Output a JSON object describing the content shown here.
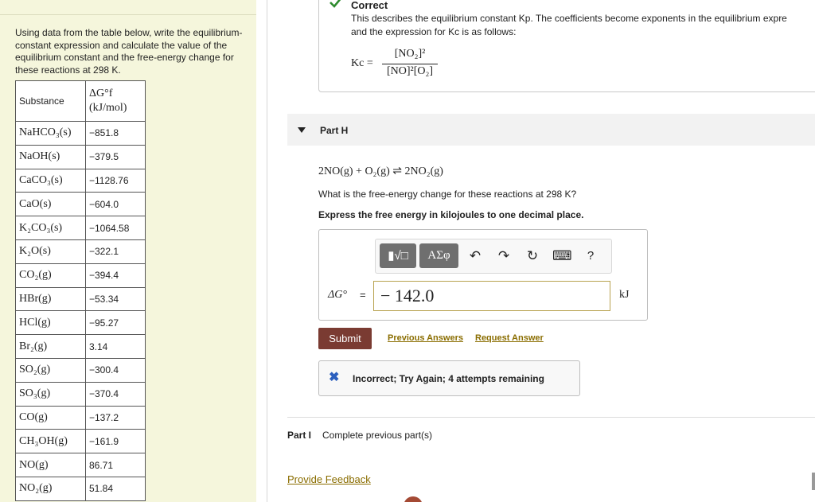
{
  "left_panel": {
    "instructions": "Using data from the table below, write the equilibrium-constant expression and calculate the value of the equilibrium constant and the free-energy change for these reactions at 298 K.",
    "table": {
      "headers": [
        "Substance",
        "ΔG°f (kJ/mol)"
      ],
      "rows": [
        {
          "substance": "NaHCO₃(s)",
          "value": "−851.8"
        },
        {
          "substance": "NaOH(s)",
          "value": "−379.5"
        },
        {
          "substance": "CaCO₃(s)",
          "value": "−1128.76"
        },
        {
          "substance": "CaO(s)",
          "value": "−604.0"
        },
        {
          "substance": "K₂CO₃(s)",
          "value": "−1064.58"
        },
        {
          "substance": "K₂O(s)",
          "value": "−322.1"
        },
        {
          "substance": "CO₂(g)",
          "value": "−394.4"
        },
        {
          "substance": "HBr(g)",
          "value": "−53.34"
        },
        {
          "substance": "HCl(g)",
          "value": "−95.27"
        },
        {
          "substance": "Br₂(g)",
          "value": "3.14"
        },
        {
          "substance": "SO₂(g)",
          "value": "−300.4"
        },
        {
          "substance": "SO₃(g)",
          "value": "−370.4"
        },
        {
          "substance": "CO(g)",
          "value": "−137.2"
        },
        {
          "substance": "CH₃OH(g)",
          "value": "−161.9"
        },
        {
          "substance": "NO(g)",
          "value": "86.71"
        },
        {
          "substance": "NO₂(g)",
          "value": "51.84"
        }
      ]
    }
  },
  "correct_box": {
    "title": "Correct",
    "line1": "This describes the equilibrium constant Kp. The coefficients become exponents in the equilibrium expre",
    "line2": "and the expression for Kc is as follows:",
    "kc_label": "Kc =",
    "numerator": "[NO₂]²",
    "denominator": "[NO]²[O₂]"
  },
  "part_h": {
    "label": "Part H",
    "reaction": "2NO(g) + O₂(g) ⇌ 2NO₂(g)",
    "question": "What is the free-energy change for these reactions at 298 K?",
    "instruction": "Express the free energy in kilojoules to one decimal place.",
    "toolbar": {
      "template_btn": "▮√□",
      "symbols_btn": "ΑΣφ",
      "undo": "↶",
      "redo": "↷",
      "reset": "↻",
      "keyboard": "⌨",
      "help": "?"
    },
    "answer_label": "ΔG° ",
    "equals": "=",
    "answer_value": "− 142.0",
    "unit": "kJ",
    "submit_label": "Submit",
    "previous_answers": "Previous Answers",
    "request_answer": "Request Answer",
    "feedback_text": "Incorrect; Try Again; 4 attempts remaining"
  },
  "part_i": {
    "label": "Part I",
    "status": "Complete previous part(s)"
  },
  "footer": {
    "provide_feedback": "Provide Feedback"
  },
  "colors": {
    "left_bg": "#f5f6dc",
    "submit_bg": "#7a3b32",
    "link": "#8a6d00",
    "check": "#2e8b2e",
    "x_icon": "#2b5fbe"
  },
  "icons": [
    "check-icon",
    "caret-down-icon",
    "undo-icon",
    "redo-icon",
    "reset-icon",
    "keyboard-icon",
    "help-icon",
    "x-icon"
  ]
}
